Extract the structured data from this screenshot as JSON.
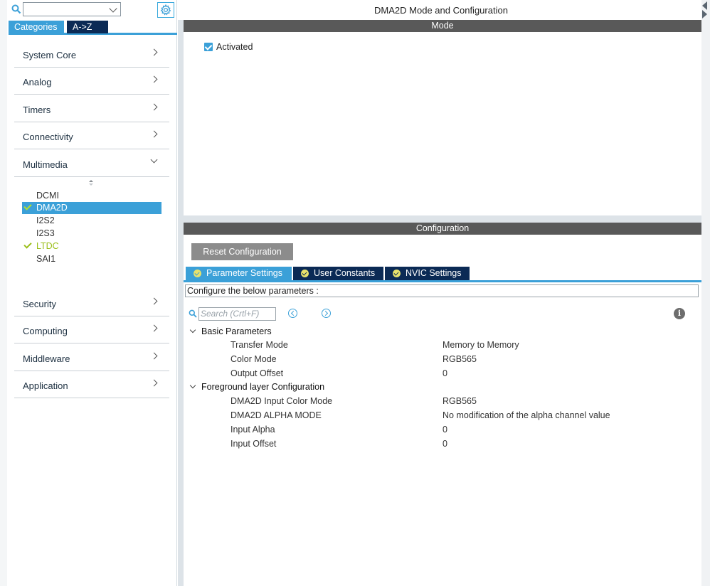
{
  "sidebar": {
    "tabs": [
      "Categories",
      "A->Z"
    ],
    "categories": [
      {
        "label": "System Core",
        "state": "collapsed"
      },
      {
        "label": "Analog",
        "state": "collapsed"
      },
      {
        "label": "Timers",
        "state": "collapsed"
      },
      {
        "label": "Connectivity",
        "state": "collapsed"
      },
      {
        "label": "Multimedia",
        "state": "expanded"
      },
      {
        "label": "Security",
        "state": "collapsed"
      },
      {
        "label": "Computing",
        "state": "collapsed"
      },
      {
        "label": "Middleware",
        "state": "collapsed"
      },
      {
        "label": "Application",
        "state": "collapsed"
      }
    ],
    "multimedia_items": [
      {
        "label": "DCMI",
        "checked": false,
        "selected": false
      },
      {
        "label": "DMA2D",
        "checked": true,
        "selected": true
      },
      {
        "label": "I2S2",
        "checked": false,
        "selected": false
      },
      {
        "label": "I2S3",
        "checked": false,
        "selected": false
      },
      {
        "label": "LTDC",
        "checked": true,
        "selected": false
      },
      {
        "label": "SAI1",
        "checked": false,
        "selected": false
      }
    ]
  },
  "main": {
    "title": "DMA2D Mode and Configuration",
    "mode": {
      "header": "Mode",
      "activated_label": "Activated",
      "activated": true
    },
    "configuration": {
      "header": "Configuration",
      "reset_label": "Reset Configuration",
      "tabs": [
        "Parameter Settings",
        "User Constants",
        "NVIC Settings"
      ],
      "active_tab": "Parameter Settings",
      "description": "Configure the below parameters :",
      "search_placeholder": "Search (Crtl+F)",
      "groups": [
        {
          "label": "Basic Parameters",
          "params": [
            {
              "name": "Transfer Mode",
              "value": "Memory to Memory"
            },
            {
              "name": "Color Mode",
              "value": "RGB565"
            },
            {
              "name": "Output Offset",
              "value": "0"
            }
          ]
        },
        {
          "label": "Foreground layer Configuration",
          "params": [
            {
              "name": "DMA2D Input Color Mode",
              "value": "RGB565"
            },
            {
              "name": "DMA2D ALPHA MODE",
              "value": "No modification of the alpha channel value"
            },
            {
              "name": "Input Alpha",
              "value": "0"
            },
            {
              "name": "Input Offset",
              "value": "0"
            }
          ]
        }
      ]
    }
  },
  "colors": {
    "accent": "#3ba0d8",
    "navy": "#0b2a55",
    "header_gray": "#595959",
    "enabled_green": "#9bbf1a"
  }
}
